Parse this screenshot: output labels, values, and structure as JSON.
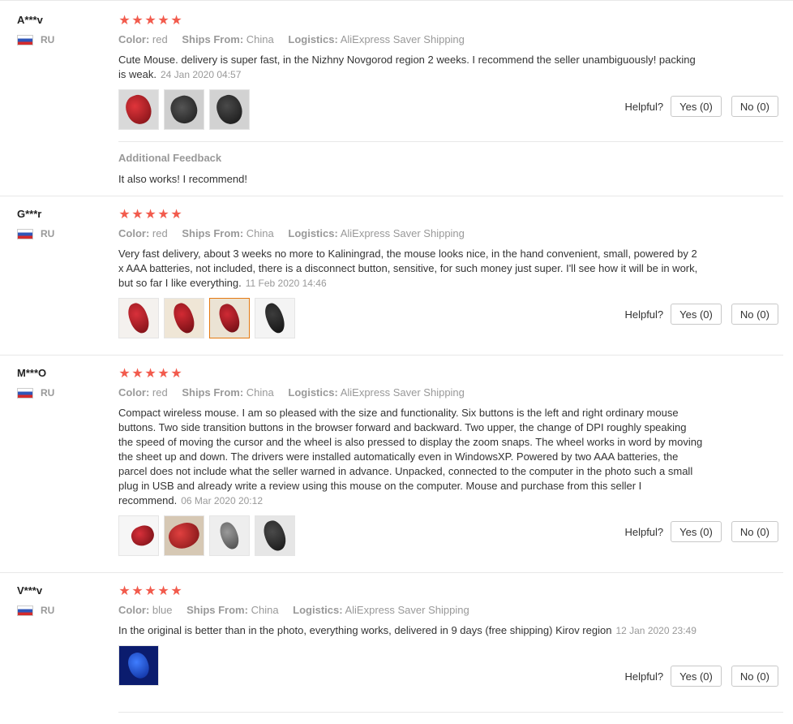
{
  "reviews": [
    {
      "user": "A***v",
      "country": "RU",
      "stars": 5,
      "color_label": "Color:",
      "color_value": "red",
      "ships_label": "Ships From:",
      "ships_value": "China",
      "logistics_label": "Logistics:",
      "logistics_value": "AliExpress Saver Shipping",
      "text": "Cute Mouse. delivery is super fast, in the Nizhny Novgorod region 2 weeks. I recommend the seller unambiguously! packing is weak.",
      "date": "24 Jan 2020 04:57",
      "helpful_label": "Helpful?",
      "yes_label": "Yes (0)",
      "no_label": "No (0)",
      "additional_title": "Additional Feedback",
      "additional_text": "It also works! I recommend!"
    },
    {
      "user": "G***r",
      "country": "RU",
      "stars": 5,
      "color_label": "Color:",
      "color_value": "red",
      "ships_label": "Ships From:",
      "ships_value": "China",
      "logistics_label": "Logistics:",
      "logistics_value": "AliExpress Saver Shipping",
      "text": "Very fast delivery, about 3 weeks no more to Kaliningrad, the mouse looks nice, in the hand convenient, small, powered by 2 x AAA batteries, not included, there is a disconnect button, sensitive, for such money just super. I'll see how it will be in work, but so far I like everything.",
      "date": "11 Feb 2020 14:46",
      "helpful_label": "Helpful?",
      "yes_label": "Yes (0)",
      "no_label": "No (0)"
    },
    {
      "user": "M***O",
      "country": "RU",
      "stars": 5,
      "color_label": "Color:",
      "color_value": "red",
      "ships_label": "Ships From:",
      "ships_value": "China",
      "logistics_label": "Logistics:",
      "logistics_value": "AliExpress Saver Shipping",
      "text": "Compact wireless mouse. I am so pleased with the size and functionality. Six buttons is the left and right ordinary mouse buttons. Two side transition buttons in the browser forward and backward. Two upper, the change of DPI roughly speaking the speed of moving the cursor and the wheel is also pressed to display the zoom snaps. The wheel works in word by moving the sheet up and down. The drivers were installed automatically even in WindowsXP. Powered by two AAA batteries, the parcel does not include what the seller warned in advance. Unpacked, connected to the computer in the photo such a small plug in USB and already write a review using this mouse on the computer. Mouse and purchase from this seller I recommend.",
      "date": "06 Mar 2020 20:12",
      "helpful_label": "Helpful?",
      "yes_label": "Yes (0)",
      "no_label": "No (0)"
    },
    {
      "user": "V***v",
      "country": "RU",
      "stars": 5,
      "color_label": "Color:",
      "color_value": "blue",
      "ships_label": "Ships From:",
      "ships_value": "China",
      "logistics_label": "Logistics:",
      "logistics_value": "AliExpress Saver Shipping",
      "text": "In the original is better than in the photo, everything works, delivered in 9 days (free shipping) Kirov region",
      "date": "12 Jan 2020 23:49",
      "helpful_label": "Helpful?",
      "yes_label": "Yes (0)",
      "no_label": "No (0)"
    }
  ],
  "star_glyph": "★",
  "colors": {
    "star": "#f25b4d",
    "muted": "#999999",
    "text": "#333333",
    "selected_thumb_border": "#e47911"
  }
}
